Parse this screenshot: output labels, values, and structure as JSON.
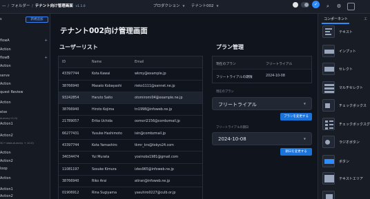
{
  "topbar": {
    "back": "—",
    "folder": "フォルダー",
    "app_name": "テナント向け管理画面",
    "version": "v1.1.0",
    "environment": "プロダクション",
    "tenant": "テナント002",
    "icons": [
      "search-icon",
      "gear-icon",
      "publish-check-icon"
    ]
  },
  "sidebar": {
    "new_button": "新規追加",
    "items": [
      {
        "label": "s",
        "plus": false,
        "sub": false
      },
      {
        "label": "",
        "plus": true,
        "sub": false
      },
      {
        "label": "flowA",
        "plus": true,
        "sub": false
      },
      {
        "label": "Action",
        "plus": false,
        "sub": false
      },
      {
        "label": "flowB",
        "plus": true,
        "sub": false
      },
      {
        "label": "Action",
        "plus": false,
        "sub": false
      },
      {
        "label": "serve",
        "plus": false,
        "sub": false
      },
      {
        "label": " Action",
        "plus": false,
        "sub": false
      },
      {
        "label": "quest Review",
        "plus": false,
        "sub": false
      },
      {
        "label": " Action",
        "plus": false,
        "sub": false
      },
      {
        "label": "else",
        "plus": false,
        "sub": false
      },
      {
        "label": "dummy+1.0)",
        "plus": false,
        "sub": true
      },
      {
        "label": "Action1",
        "plus": false,
        "sub": false
      },
      {
        "label": "Action2",
        "plus": false,
        "sub": false
      },
      {
        "label": "30 * data.dummy + 10.0)",
        "plus": false,
        "sub": true
      },
      {
        "label": "Action",
        "plus": false,
        "sub": false
      },
      {
        "label": "Action2",
        "plus": false,
        "sub": false
      },
      {
        "label": "loop",
        "plus": false,
        "sub": false
      },
      {
        "label": " Action",
        "plus": false,
        "sub": false
      },
      {
        "label": "Action1",
        "plus": false,
        "sub": false
      },
      {
        "label": "Action2",
        "plus": false,
        "sub": false
      }
    ]
  },
  "main": {
    "page_title": "テナント002向け管理画面",
    "users": {
      "title": "ユーザーリスト",
      "columns": [
        "ID",
        "Name",
        "Email"
      ],
      "rows": [
        [
          "43397744",
          "Kota Kawai",
          "wkmy@example.jp"
        ],
        [
          "38766940",
          "Masato Kobayashi",
          "rieko1111@sannet.ne.jp"
        ],
        [
          "93242854",
          "Haruto Saito",
          "otomiromi04@example.ne.jp"
        ],
        [
          "38766940",
          "Hiroto Kojima",
          "tn1998@infoweb.ne.jp"
        ],
        [
          "21789057",
          "Erika Uchida",
          "oomori2156@combzmail.jp"
        ],
        [
          "66277431",
          "Yusuke Hashimoto",
          "isin@combzmail.jp"
        ],
        [
          "43397744",
          "Kota Yamashiro",
          "tkmr_krs@tokyo24.com"
        ],
        [
          "34034474",
          "Yui Murata",
          "yosinobs1981@gmail.com"
        ],
        [
          "11081197",
          "Sosuke Kimura",
          "izles965@infoweb.ne.jp"
        ],
        [
          "38766940",
          "Riko Arai",
          "atiran@infoweb.ne.jp"
        ],
        [
          "01906912",
          "Rina Sugiyama",
          "yasuhiro0227@culb.or.jp"
        ]
      ],
      "selected_row": 2
    },
    "plan": {
      "title": "プラン管理",
      "columns": [
        "現在のプラン",
        "フリートライアル"
      ],
      "rows": [
        [
          "フリートライアルの期限",
          "2024-10-08"
        ]
      ],
      "current_plan_label": "現在のプラン",
      "current_plan_value": "フリートライアル",
      "change_plan_button": "プランを変更する",
      "trial_end_label": "フリートライアルの期日",
      "trial_end_value": "2024-10-08",
      "change_date_button": "期日を変更する"
    }
  },
  "rightpanel": {
    "tabs": [
      "コンポーネント",
      "エ"
    ],
    "components": [
      {
        "label": "テキスト",
        "icon": "text-component-icon"
      },
      {
        "label": "インプット",
        "icon": "input-component-icon"
      },
      {
        "label": "セレクト",
        "icon": "select-component-icon"
      },
      {
        "label": "マルチセレクト",
        "icon": "multiselect-component-icon"
      },
      {
        "label": "チェックボックス",
        "icon": "checkbox-component-icon"
      },
      {
        "label": "チェックボックスグ",
        "icon": "checkbox-group-component-icon"
      },
      {
        "label": "ラジオボタン",
        "icon": "radio-component-icon"
      },
      {
        "label": "ボタン",
        "icon": "button-component-icon"
      },
      {
        "label": "テキストエリア",
        "icon": "textarea-component-icon"
      },
      {
        "label": "",
        "icon": "component-icon"
      }
    ]
  },
  "colors": {
    "accent": "#2d8cff",
    "button": "#1a73d9",
    "background": "#10141d"
  }
}
